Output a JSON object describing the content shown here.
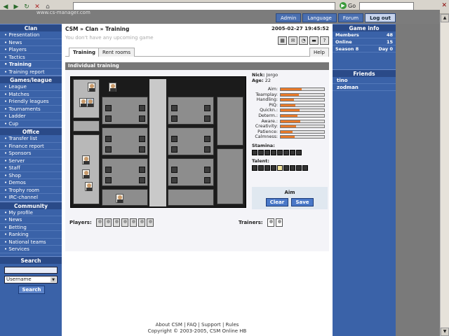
{
  "browser": {
    "url": "",
    "go": "Go"
  },
  "site": {
    "brand": "www.cs-manager.com"
  },
  "topnav": [
    "Admin",
    "Language",
    "Forum",
    "Log out"
  ],
  "sidebar": {
    "sections": [
      {
        "title": "Clan",
        "items": [
          "Presentation",
          "News",
          "Players",
          "Tactics",
          "Training",
          "Training report"
        ]
      },
      {
        "title": "Games/league",
        "items": [
          "League",
          "Matches",
          "Friendly leagues",
          "Tournaments",
          "Ladder",
          "Cup"
        ]
      },
      {
        "title": "Office",
        "items": [
          "Transfer list",
          "Finance report",
          "Sponsors",
          "Server",
          "Staff",
          "Shop",
          "Demos",
          "Trophy room",
          "IRC-channel"
        ]
      },
      {
        "title": "Community",
        "items": [
          "My profile",
          "News",
          "Betting",
          "Ranking",
          "National teams",
          "Services"
        ]
      }
    ],
    "search": {
      "title": "Search",
      "select_value": "Username",
      "button": "Search"
    }
  },
  "main": {
    "breadcrumb": "CSM » Clan » Training",
    "datetime": "2005-02-27 19:45:52",
    "subtitle": "You don't have any upcoming game",
    "tabs": [
      "Training",
      "Rent rooms"
    ],
    "help": "Help",
    "panel_title": "Individual training",
    "nick_label": "Nick:",
    "nick": "Jorgo",
    "age_label": "Age:",
    "age": "22",
    "skills": [
      {
        "name": "Aim:",
        "value": 0.48
      },
      {
        "name": "Teamplay:",
        "value": 0.42
      },
      {
        "name": "Handling:",
        "value": 0.3
      },
      {
        "name": "PIQ:",
        "value": 0.34
      },
      {
        "name": "Quickn.:",
        "value": 0.44
      },
      {
        "name": "Determ.:",
        "value": 0.38
      },
      {
        "name": "Aware.:",
        "value": 0.45
      },
      {
        "name": "Creativity:",
        "value": 0.36
      },
      {
        "name": "Patience:",
        "value": 0.28
      },
      {
        "name": "Calmness:",
        "value": 0.32
      }
    ],
    "stamina_label": "Stamina:",
    "talent_label": "Talent:",
    "aim_title": "Aim",
    "clear": "Clear",
    "save": "Save",
    "players_label": "Players:",
    "trainers_label": "Trainers:",
    "footer_links": "About CSM | FAQ | Support | Rules",
    "copyright": "Copyright © 2003-2005, CSM Online HB"
  },
  "gameinfo": {
    "title": "Game info",
    "rows": [
      {
        "label": "Members",
        "value": "48"
      },
      {
        "label": "Online",
        "value": "15"
      },
      {
        "label": "Season 8",
        "value": "Day 0"
      }
    ]
  },
  "friends": {
    "title": "Friends",
    "items": [
      "tino",
      "zodman"
    ]
  }
}
